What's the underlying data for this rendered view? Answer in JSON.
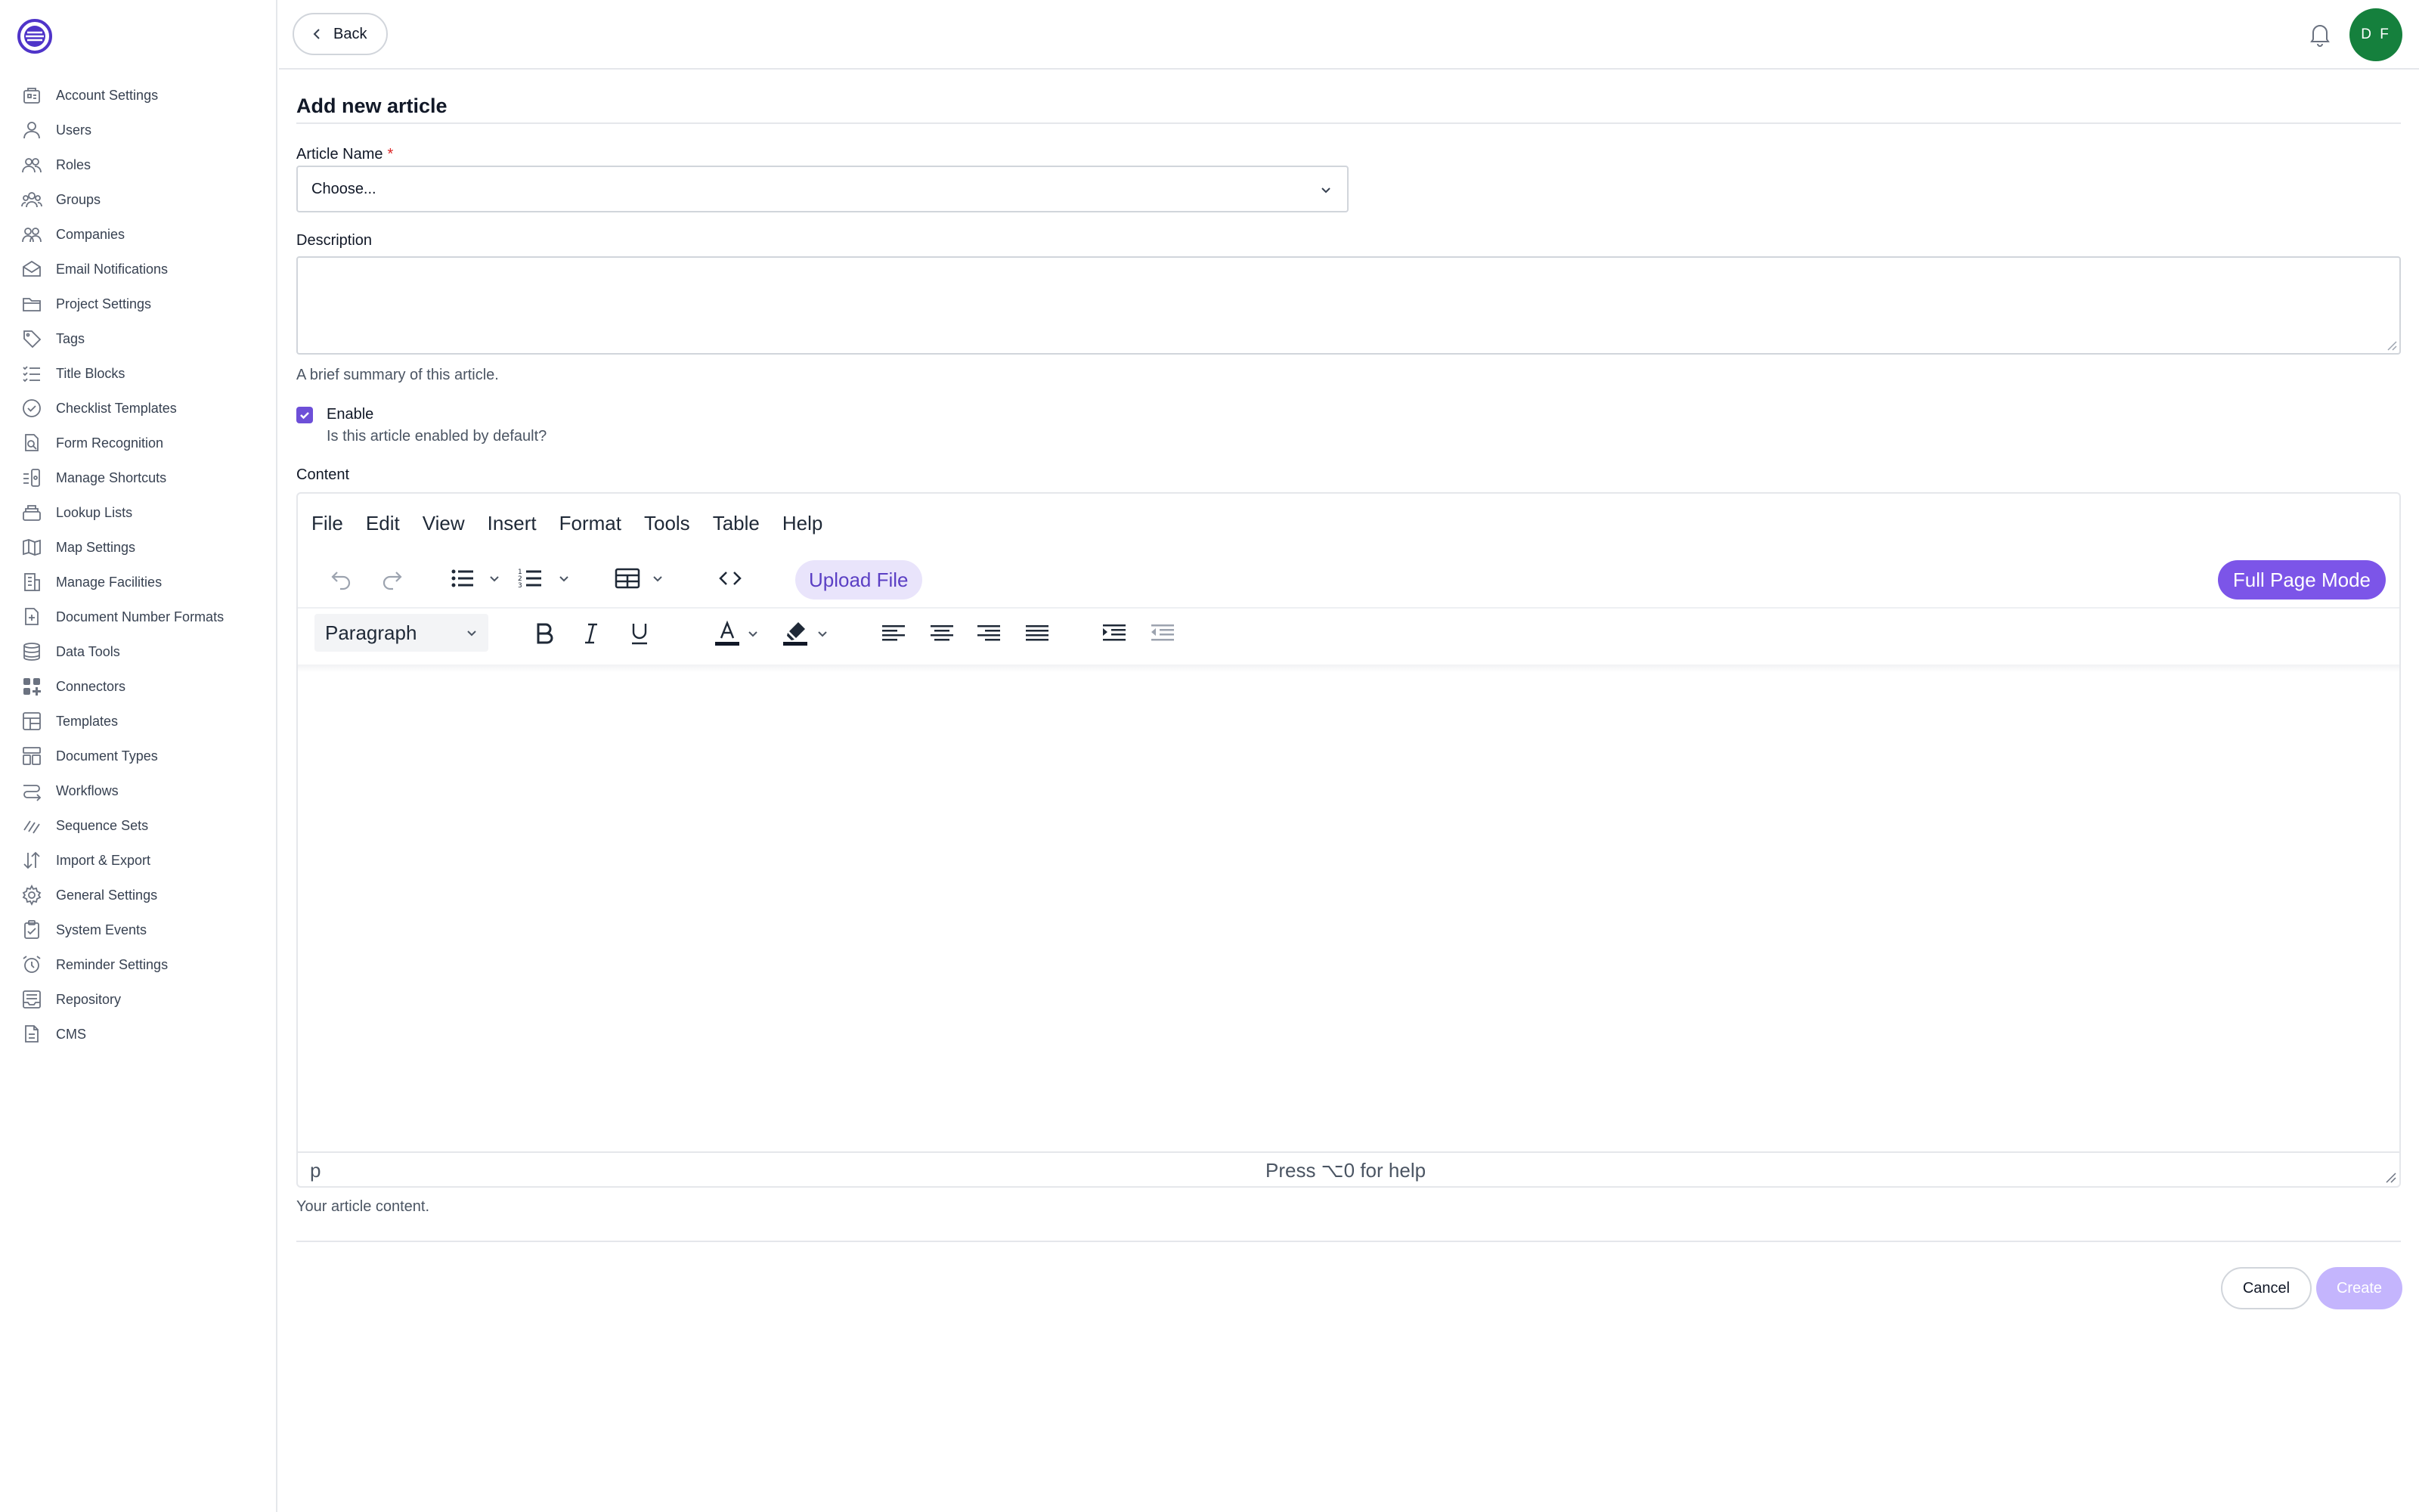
{
  "colors": {
    "accent": "#7c55e8",
    "accent_light": "#e9e4fb",
    "avatar_bg": "#15803d",
    "required": "#dc2626",
    "create_disabled": "#c4b5fd"
  },
  "header": {
    "back_label": "Back",
    "avatar_initials": "D F"
  },
  "sidebar": {
    "items": [
      {
        "label": "Account Settings",
        "icon": "building-icon"
      },
      {
        "label": "Users",
        "icon": "user-icon"
      },
      {
        "label": "Roles",
        "icon": "users-icon"
      },
      {
        "label": "Groups",
        "icon": "group-icon"
      },
      {
        "label": "Companies",
        "icon": "companies-icon"
      },
      {
        "label": "Email Notifications",
        "icon": "envelope-icon"
      },
      {
        "label": "Project Settings",
        "icon": "folder-icon"
      },
      {
        "label": "Tags",
        "icon": "tag-icon"
      },
      {
        "label": "Title Blocks",
        "icon": "list-icon"
      },
      {
        "label": "Checklist Templates",
        "icon": "check-circle-icon"
      },
      {
        "label": "Form Recognition",
        "icon": "document-search-icon"
      },
      {
        "label": "Manage Shortcuts",
        "icon": "shortcut-icon"
      },
      {
        "label": "Lookup Lists",
        "icon": "stack-icon"
      },
      {
        "label": "Map Settings",
        "icon": "map-icon"
      },
      {
        "label": "Manage Facilities",
        "icon": "office-icon"
      },
      {
        "label": "Document Number Formats",
        "icon": "document-plus-icon"
      },
      {
        "label": "Data Tools",
        "icon": "database-icon"
      },
      {
        "label": "Connectors",
        "icon": "grid-plus-icon"
      },
      {
        "label": "Templates",
        "icon": "template-icon"
      },
      {
        "label": "Document Types",
        "icon": "layout-icon"
      },
      {
        "label": "Workflows",
        "icon": "workflow-icon"
      },
      {
        "label": "Sequence Sets",
        "icon": "sequence-icon"
      },
      {
        "label": "Import & Export",
        "icon": "arrows-updown-icon"
      },
      {
        "label": "General Settings",
        "icon": "gear-icon"
      },
      {
        "label": "System Events",
        "icon": "clipboard-check-icon"
      },
      {
        "label": "Reminder Settings",
        "icon": "alarm-icon"
      },
      {
        "label": "Repository",
        "icon": "archive-icon"
      },
      {
        "label": "CMS",
        "icon": "page-icon"
      }
    ]
  },
  "form": {
    "title": "Add new article",
    "article_name_label": "Article Name",
    "required_mark": "*",
    "article_name_value": "Choose...",
    "description_label": "Description",
    "description_value": "",
    "description_help": "A brief summary of this article.",
    "enable_label": "Enable",
    "enable_checked": true,
    "enable_help": "Is this article enabled by default?",
    "content_label": "Content",
    "content_help": "Your article content."
  },
  "editor": {
    "menu": [
      "File",
      "Edit",
      "View",
      "Insert",
      "Format",
      "Tools",
      "Table",
      "Help"
    ],
    "upload_label": "Upload File",
    "full_page_label": "Full Page Mode",
    "block_format": "Paragraph",
    "status_path": "p",
    "status_help": "Press ⌥0 for help"
  },
  "actions": {
    "cancel_label": "Cancel",
    "create_label": "Create"
  }
}
